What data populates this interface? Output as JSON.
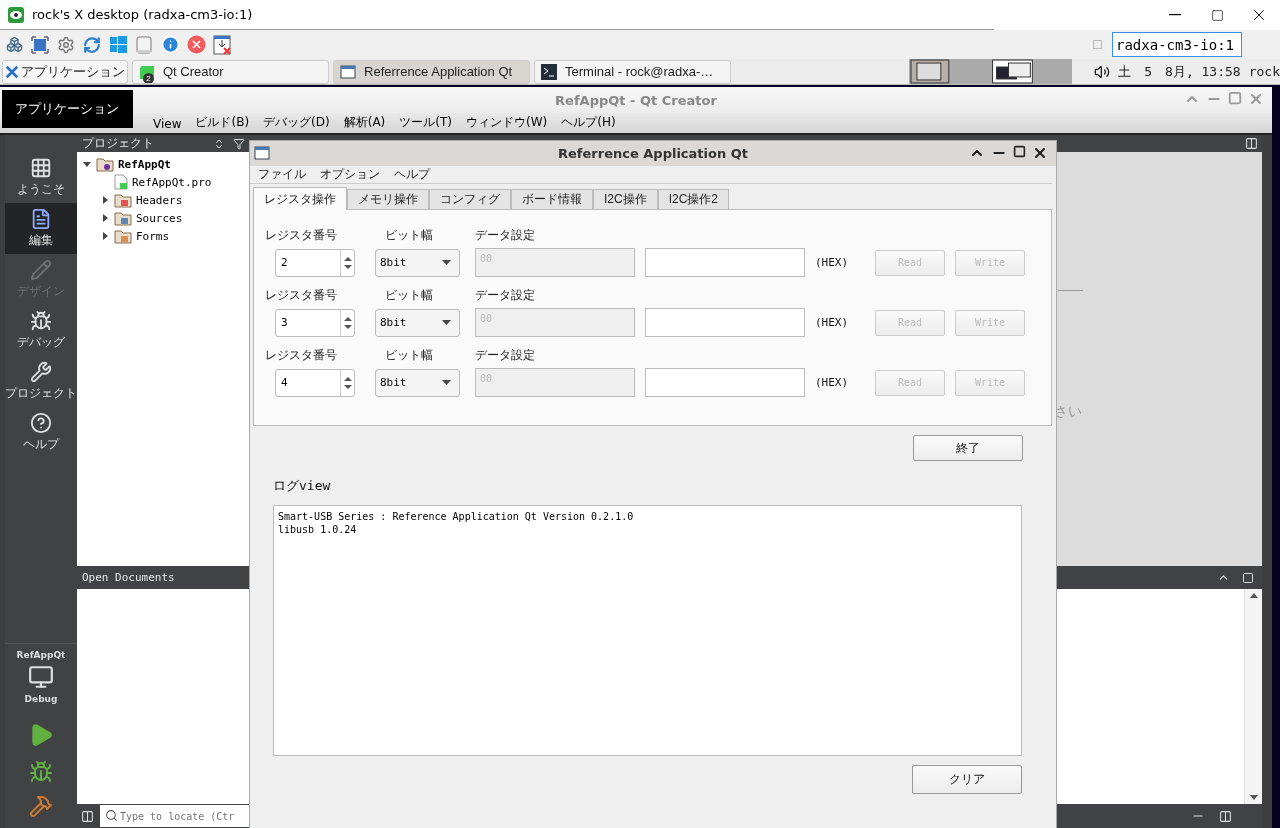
{
  "viewer": {
    "title": "rock's X desktop (radxa-cm3-io:1)",
    "host": "radxa-cm3-io:1"
  },
  "taskbar": {
    "menu_button": "アプリケーション",
    "tasks": [
      {
        "kind": "qt",
        "label": "Qt Creator",
        "badge": "2",
        "selected": false
      },
      {
        "kind": "window",
        "label": "Referrence Application Qt",
        "selected": true
      },
      {
        "kind": "terminal",
        "label": "Terminal - rock@radxa-…",
        "selected": false
      }
    ],
    "clock": "土　5　8月, 13:58",
    "user": "rock"
  },
  "tooltip": "アプリケーション",
  "creator": {
    "title": "RefAppQt - Qt Creator",
    "menu": [
      "View",
      "ビルド(B)",
      "デバッグ(D)",
      "解析(A)",
      "ツール(T)",
      "ウィンドウ(W)",
      "ヘルプ(H)"
    ],
    "modes": [
      {
        "kind": "welcome",
        "label": "ようこそ",
        "selected": false,
        "disabled": false
      },
      {
        "kind": "edit",
        "label": "編集",
        "selected": true,
        "disabled": false
      },
      {
        "kind": "design",
        "label": "デザイン",
        "selected": false,
        "disabled": true
      },
      {
        "kind": "debug",
        "label": "デバッグ",
        "selected": false,
        "disabled": false
      },
      {
        "kind": "project",
        "label": "プロジェクト",
        "selected": false,
        "disabled": false
      },
      {
        "kind": "help",
        "label": "ヘルプ",
        "selected": false,
        "disabled": false
      }
    ],
    "kit": {
      "project": "RefAppQt",
      "config": "Debug"
    },
    "project_panel": {
      "title": "プロジェクト",
      "tree": [
        {
          "kind": "project",
          "label": "RefAppQt",
          "expanded": true,
          "children": [
            {
              "kind": "pro",
              "label": "RefAppQt.pro"
            },
            {
              "kind": "headers",
              "label": "Headers",
              "expanded": false
            },
            {
              "kind": "sources",
              "label": "Sources",
              "expanded": false
            },
            {
              "kind": "forms",
              "label": "Forms",
              "expanded": false
            }
          ]
        }
      ]
    },
    "open_documents": "Open Documents",
    "locate": {
      "placeholder": "Type to locate (Ctr"
    },
    "editor_hint": "さい"
  },
  "app": {
    "title": "Referrence Application Qt",
    "menu": [
      "ファイル",
      "オプション",
      "ヘルプ"
    ],
    "tabs": [
      {
        "label": "レジスタ操作",
        "selected": true
      },
      {
        "label": "メモリ操作",
        "selected": false
      },
      {
        "label": "コンフィグ",
        "selected": false
      },
      {
        "label": "ボード情報",
        "selected": false
      },
      {
        "label": "I2C操作",
        "selected": false
      },
      {
        "label": "I2C操作2",
        "selected": false
      }
    ],
    "rows": [
      {
        "reg_label": "レジスタ番号",
        "reg_value": "2",
        "width_label": "ビット幅",
        "width_value": "8bit",
        "data_label": "データ設定",
        "data_field": {
          "placeholder": "00",
          "disabled": true
        },
        "hex": "(HEX)",
        "read": {
          "label": "Read",
          "disabled": true
        },
        "write": {
          "label": "Write",
          "disabled": true
        }
      },
      {
        "reg_label": "レジスタ番号",
        "reg_value": "3",
        "width_label": "ビット幅",
        "width_value": "8bit",
        "data_label": "データ設定",
        "data_field": {
          "placeholder": "00",
          "disabled": true
        },
        "hex": "(HEX)",
        "read": {
          "label": "Read",
          "disabled": true
        },
        "write": {
          "label": "Write",
          "disabled": true
        }
      },
      {
        "reg_label": "レジスタ番号",
        "reg_value": "4",
        "width_label": "ビット幅",
        "width_value": "8bit",
        "data_label": "データ設定",
        "data_field": {
          "placeholder": "00",
          "disabled": true
        },
        "hex": "(HEX)",
        "read": {
          "label": "Read",
          "disabled": true
        },
        "write": {
          "label": "Write",
          "disabled": true
        }
      }
    ],
    "exit": "終了",
    "log_label": "ログview",
    "log_lines": [
      "Smart-USB Series : Reference Application Qt Version 0.2.1.0",
      "libusb 1.0.24"
    ],
    "clear": "クリア"
  }
}
